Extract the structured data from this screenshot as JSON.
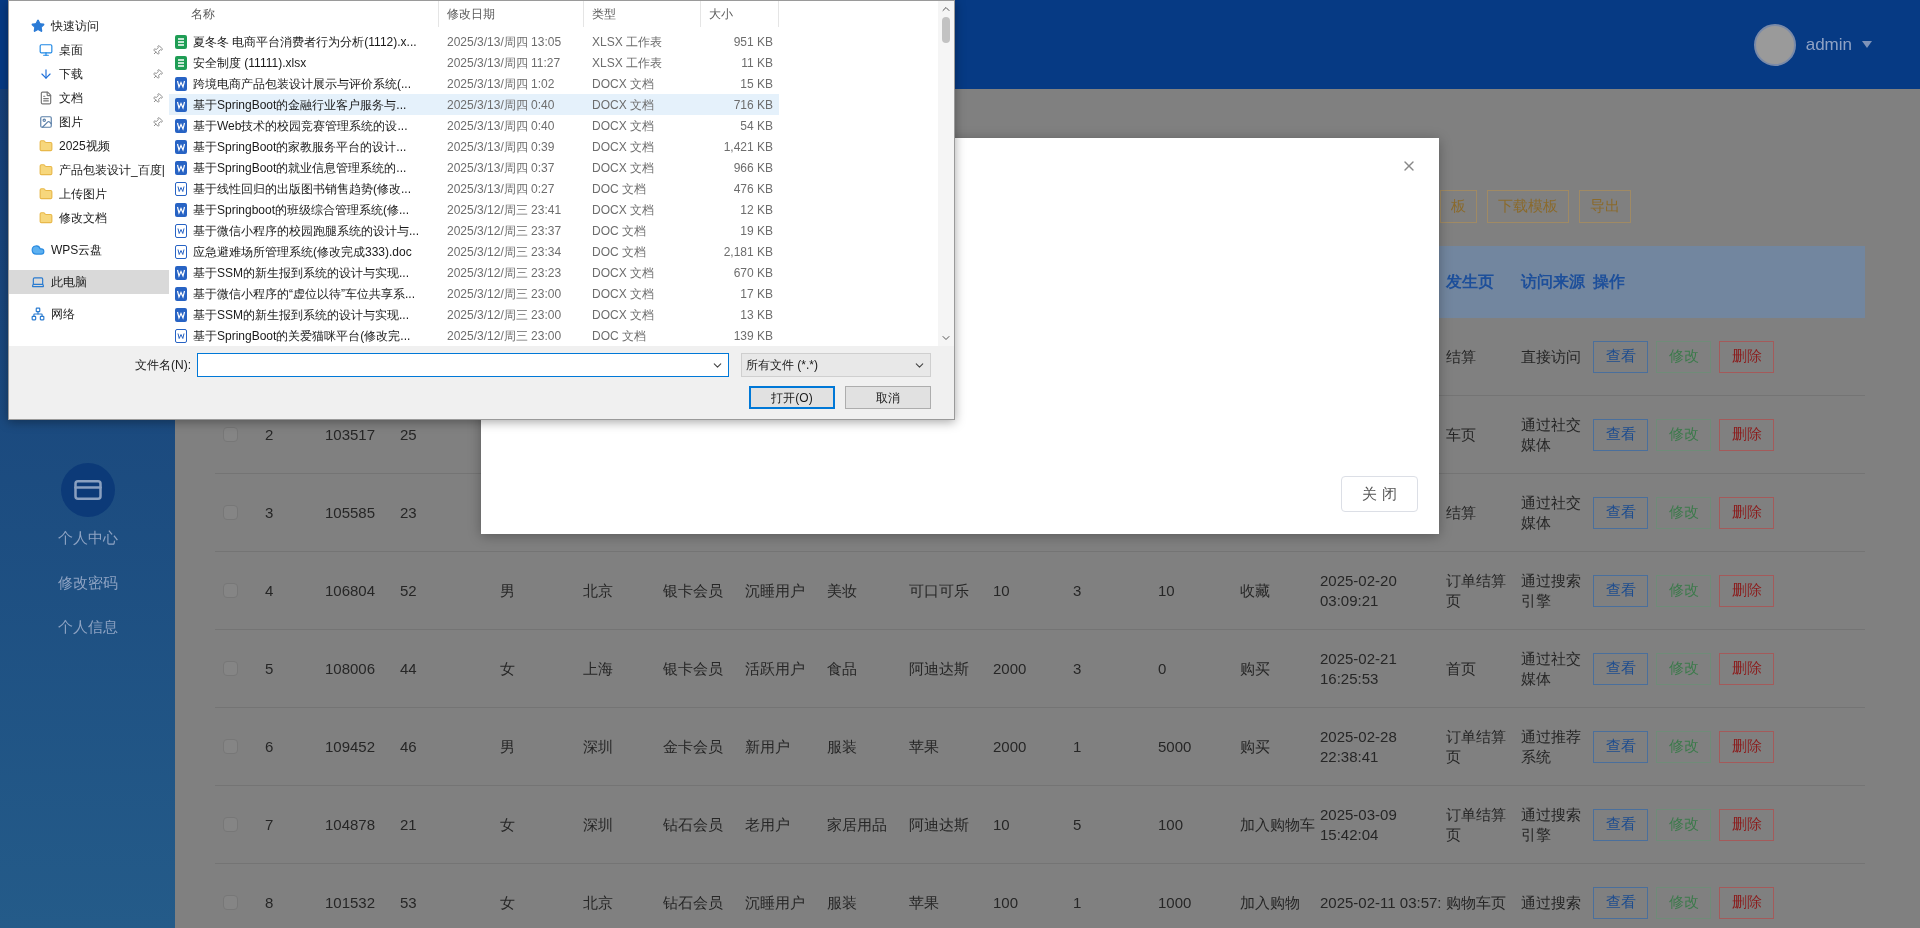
{
  "file_dialog": {
    "nav": [
      {
        "label": "快速访问",
        "kind": "star",
        "pinned": false,
        "selected": false
      },
      {
        "label": "桌面",
        "kind": "desktop",
        "pinned": true,
        "selected": false
      },
      {
        "label": "下载",
        "kind": "download",
        "pinned": true,
        "selected": false
      },
      {
        "label": "文档",
        "kind": "document",
        "pinned": true,
        "selected": false
      },
      {
        "label": "图片",
        "kind": "picture",
        "pinned": true,
        "selected": false
      },
      {
        "label": "2025视频",
        "kind": "folder",
        "pinned": false,
        "selected": false
      },
      {
        "label": "产品包装设计_百度|",
        "kind": "folder",
        "pinned": false,
        "selected": false
      },
      {
        "label": "上传图片",
        "kind": "folder",
        "pinned": false,
        "selected": false
      },
      {
        "label": "修改文档",
        "kind": "folder",
        "pinned": false,
        "selected": false
      },
      {
        "label": "WPS云盘",
        "kind": "cloud",
        "pinned": false,
        "selected": false
      },
      {
        "label": "此电脑",
        "kind": "computer",
        "pinned": false,
        "selected": true
      },
      {
        "label": "网络",
        "kind": "network",
        "pinned": false,
        "selected": false
      }
    ],
    "columns": [
      "名称",
      "修改日期",
      "类型",
      "大小"
    ],
    "files": [
      {
        "name": "夏冬冬 电商平台消费者行为分析(1112).x...",
        "date": "2025/3/13/周四 13:05",
        "type": "XLSX 工作表",
        "size": "951 KB",
        "kind": "xlsx",
        "selected": false
      },
      {
        "name": "安全制度 (11111).xlsx",
        "date": "2025/3/13/周四 11:27",
        "type": "XLSX 工作表",
        "size": "11 KB",
        "kind": "xlsx",
        "selected": false
      },
      {
        "name": "跨境电商产品包装设计展示与评价系统(...",
        "date": "2025/3/13/周四 1:02",
        "type": "DOCX 文档",
        "size": "15 KB",
        "kind": "docx",
        "selected": false
      },
      {
        "name": "基于SpringBoot的金融行业客户服务与...",
        "date": "2025/3/13/周四 0:40",
        "type": "DOCX 文档",
        "size": "716 KB",
        "kind": "docx",
        "selected": true
      },
      {
        "name": "基于Web技术的校园竞赛管理系统的设...",
        "date": "2025/3/13/周四 0:40",
        "type": "DOCX 文档",
        "size": "54 KB",
        "kind": "docx",
        "selected": false
      },
      {
        "name": "基于SpringBoot的家教服务平台的设计...",
        "date": "2025/3/13/周四 0:39",
        "type": "DOCX 文档",
        "size": "1,421 KB",
        "kind": "docx",
        "selected": false
      },
      {
        "name": "基于SpringBoot的就业信息管理系统的...",
        "date": "2025/3/13/周四 0:37",
        "type": "DOCX 文档",
        "size": "966 KB",
        "kind": "docx",
        "selected": false
      },
      {
        "name": "基于线性回归的出版图书销售趋势(修改...",
        "date": "2025/3/13/周四 0:27",
        "type": "DOC 文档",
        "size": "476 KB",
        "kind": "doc",
        "selected": false
      },
      {
        "name": "基于Springboot的班级综合管理系统(修...",
        "date": "2025/3/12/周三 23:41",
        "type": "DOCX 文档",
        "size": "12 KB",
        "kind": "docx",
        "selected": false
      },
      {
        "name": "基于微信小程序的校园跑腿系统的设计与...",
        "date": "2025/3/12/周三 23:37",
        "type": "DOC 文档",
        "size": "19 KB",
        "kind": "doc",
        "selected": false
      },
      {
        "name": "应急避难场所管理系统(修改完成333).doc",
        "date": "2025/3/12/周三 23:34",
        "type": "DOC 文档",
        "size": "2,181 KB",
        "kind": "doc",
        "selected": false
      },
      {
        "name": "基于SSM的新生报到系统的设计与实现...",
        "date": "2025/3/12/周三 23:23",
        "type": "DOCX 文档",
        "size": "670 KB",
        "kind": "docx",
        "selected": false
      },
      {
        "name": "基于微信小程序的“虚位以待”车位共享系...",
        "date": "2025/3/12/周三 23:00",
        "type": "DOCX 文档",
        "size": "17 KB",
        "kind": "docx",
        "selected": false
      },
      {
        "name": "基于SSM的新生报到系统的设计与实现...",
        "date": "2025/3/12/周三 23:00",
        "type": "DOCX 文档",
        "size": "13 KB",
        "kind": "docx",
        "selected": false
      },
      {
        "name": "基于SpringBoot的关爱猫咪平台(修改完...",
        "date": "2025/3/12/周三 23:00",
        "type": "DOC 文档",
        "size": "139 KB",
        "kind": "doc",
        "selected": false
      }
    ],
    "filename_label": "文件名(N):",
    "filter": "所有文件 (*.*)",
    "buttons": [
      "打开(O)",
      "取消"
    ]
  },
  "header": {
    "user": "admin"
  },
  "sidebar": {
    "items": [
      {
        "label": "个人中心",
        "kind": "icon"
      },
      {
        "label": "修改密码",
        "kind": "link"
      },
      {
        "label": "个人信息",
        "kind": "link"
      }
    ]
  },
  "toolbar": {
    "buttons": [
      "板",
      "下载模板",
      "导出"
    ]
  },
  "modal": {
    "buttons": [
      "关 闭"
    ]
  },
  "table": {
    "columns": [
      null,
      null,
      null,
      null,
      null,
      null,
      null,
      null,
      null,
      null,
      null,
      null,
      null,
      null,
      "发生页",
      "访问来源",
      "操作"
    ],
    "rows": [
      {
        "cells": [
          null,
          null,
          null,
          null,
          null,
          null,
          null,
          null,
          null,
          null,
          null,
          null,
          null,
          null,
          "结算",
          "直接访问"
        ],
        "actions": [
          "查看",
          "修改",
          "删除"
        ]
      },
      {
        "checked": false,
        "cells": [
          "2",
          "103517",
          "25",
          null,
          null,
          null,
          null,
          null,
          null,
          null,
          null,
          null,
          null,
          null,
          "车页",
          "通过社交媒体"
        ],
        "actions": [
          "查看",
          "修改",
          "删除"
        ]
      },
      {
        "checked": false,
        "cells": [
          "3",
          "105585",
          "23",
          null,
          null,
          null,
          null,
          null,
          null,
          null,
          null,
          null,
          null,
          null,
          "结算",
          "通过社交媒体"
        ],
        "actions": [
          "查看",
          "修改",
          "删除"
        ]
      },
      {
        "checked": false,
        "cells": [
          "4",
          "106804",
          "52",
          "男",
          "北京",
          "银卡会员",
          "沉睡用户",
          "美妆",
          "可口可乐",
          "10",
          "3",
          "10",
          "收藏",
          "2025-02-20 03:09:21",
          "订单结算页",
          "通过搜索引擎"
        ],
        "actions": [
          "查看",
          "修改",
          "删除"
        ]
      },
      {
        "checked": false,
        "cells": [
          "5",
          "108006",
          "44",
          "女",
          "上海",
          "银卡会员",
          "活跃用户",
          "食品",
          "阿迪达斯",
          "2000",
          "3",
          "0",
          "购买",
          "2025-02-21 16:25:53",
          "首页",
          "通过社交媒体"
        ],
        "actions": [
          "查看",
          "修改",
          "删除"
        ]
      },
      {
        "checked": false,
        "cells": [
          "6",
          "109452",
          "46",
          "男",
          "深圳",
          "金卡会员",
          "新用户",
          "服装",
          "苹果",
          "2000",
          "1",
          "5000",
          "购买",
          "2025-02-28 22:38:41",
          "订单结算页",
          "通过推荐系统"
        ],
        "actions": [
          "查看",
          "修改",
          "删除"
        ]
      },
      {
        "checked": false,
        "cells": [
          "7",
          "104878",
          "21",
          "女",
          "深圳",
          "钻石会员",
          "老用户",
          "家居用品",
          "阿迪达斯",
          "10",
          "5",
          "100",
          "加入购物车",
          "2025-03-09 15:42:04",
          "订单结算页",
          "通过搜索引擎"
        ],
        "actions": [
          "查看",
          "修改",
          "删除"
        ]
      },
      {
        "checked": false,
        "cells": [
          "8",
          "101532",
          "53",
          "女",
          "北京",
          "钻石会员",
          "沉睡用户",
          "服装",
          "苹果",
          "100",
          "1",
          "1000",
          "加入购物",
          "2025-02-11 03:57:",
          "购物车页",
          "通过搜索"
        ],
        "actions": [
          "查看",
          "修改",
          "删除"
        ]
      }
    ]
  }
}
